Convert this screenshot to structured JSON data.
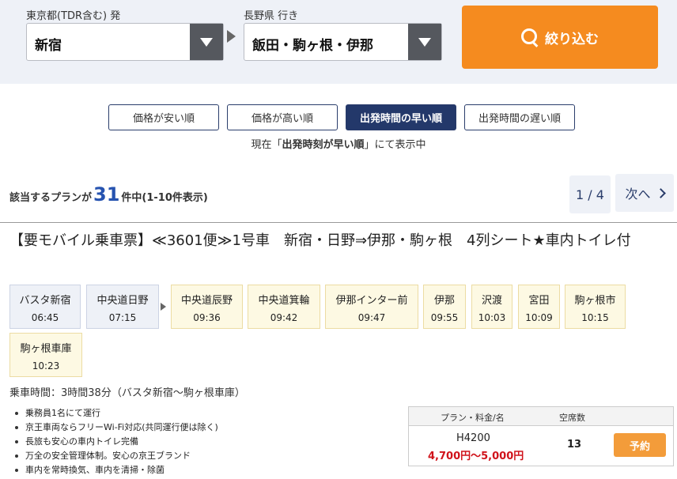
{
  "search": {
    "origin_label": "東京都(TDR含む) 発",
    "origin_value": "新宿",
    "destination_label": "長野県 行き",
    "destination_value": "飯田・駒ヶ根・伊那",
    "filter_button_label": "絞り込む"
  },
  "sort": {
    "options": [
      {
        "label": "価格が安い順",
        "active": false
      },
      {
        "label": "価格が高い順",
        "active": false
      },
      {
        "label": "出発時間の早い順",
        "active": true
      },
      {
        "label": "出発時間の遅い順",
        "active": false
      }
    ],
    "status_prefix": "現在「",
    "status_value": "出発時刻が早い順",
    "status_suffix": "」にて表示中"
  },
  "results": {
    "count_prefix": "該当するプランが",
    "count": "31",
    "count_suffix": "件中(1-10件表示)",
    "page_indicator": "1 / 4",
    "next_label": "次へ"
  },
  "plan": {
    "title": "【要モバイル乗車票】≪3601便≫1号車　新宿・日野⇒伊那・駒ヶ根　4列シート★車内トイレ付",
    "stops": [
      {
        "name": "バスタ新宿",
        "time": "06:45",
        "type": "boarding"
      },
      {
        "name": "中央道日野",
        "time": "07:15",
        "type": "boarding"
      },
      {
        "name": "中央道辰野",
        "time": "09:36",
        "type": "alighting"
      },
      {
        "name": "中央道箕輪",
        "time": "09:42",
        "type": "alighting"
      },
      {
        "name": "伊那インター前",
        "time": "09:47",
        "type": "alighting"
      },
      {
        "name": "伊那",
        "time": "09:55",
        "type": "alighting"
      },
      {
        "name": "沢渡",
        "time": "10:03",
        "type": "alighting"
      },
      {
        "name": "宮田",
        "time": "10:09",
        "type": "alighting"
      },
      {
        "name": "駒ヶ根市",
        "time": "10:15",
        "type": "alighting"
      },
      {
        "name": "駒ヶ根車庫",
        "time": "10:23",
        "type": "alighting"
      }
    ],
    "duration": "乗車時間：3時間38分（バスタ新宿～駒ヶ根車庫）",
    "features": [
      "乗務員1名にて運行",
      "京王車両ならフリーWi-Fi対応(共同運行便は除く)",
      "長旅も安心の車内トイレ完備",
      "万全の安全管理体制。安心の京王ブランド",
      "車内を常時換気、車内を清掃・除菌"
    ],
    "price_table": {
      "header_plan": "プラン・料金/名",
      "header_seats": "空席数",
      "plan_code": "H4200",
      "price_range": "4,700円～5,000円",
      "seats": "13",
      "reserve_label": "予約"
    }
  },
  "colors": {
    "accent_orange": "#f58b1f",
    "navy": "#23386a",
    "price_red": "#d0131b",
    "count_blue": "#2653b0"
  }
}
